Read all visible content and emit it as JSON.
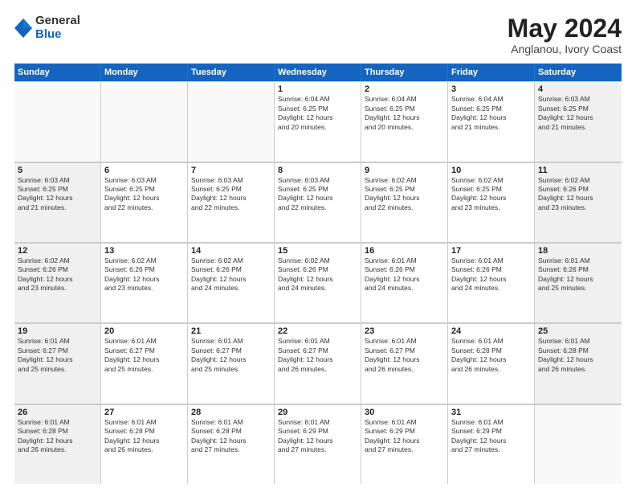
{
  "logo": {
    "general": "General",
    "blue": "Blue"
  },
  "title": "May 2024",
  "location": "Anglanou, Ivory Coast",
  "days": [
    "Sunday",
    "Monday",
    "Tuesday",
    "Wednesday",
    "Thursday",
    "Friday",
    "Saturday"
  ],
  "weeks": [
    [
      {
        "day": "",
        "text": ""
      },
      {
        "day": "",
        "text": ""
      },
      {
        "day": "",
        "text": ""
      },
      {
        "day": "1",
        "text": "Sunrise: 6:04 AM\nSunset: 6:25 PM\nDaylight: 12 hours\nand 20 minutes."
      },
      {
        "day": "2",
        "text": "Sunrise: 6:04 AM\nSunset: 6:25 PM\nDaylight: 12 hours\nand 20 minutes."
      },
      {
        "day": "3",
        "text": "Sunrise: 6:04 AM\nSunset: 6:25 PM\nDaylight: 12 hours\nand 21 minutes."
      },
      {
        "day": "4",
        "text": "Sunrise: 6:03 AM\nSunset: 6:25 PM\nDaylight: 12 hours\nand 21 minutes."
      }
    ],
    [
      {
        "day": "5",
        "text": "Sunrise: 6:03 AM\nSunset: 6:25 PM\nDaylight: 12 hours\nand 21 minutes."
      },
      {
        "day": "6",
        "text": "Sunrise: 6:03 AM\nSunset: 6:25 PM\nDaylight: 12 hours\nand 22 minutes."
      },
      {
        "day": "7",
        "text": "Sunrise: 6:03 AM\nSunset: 6:25 PM\nDaylight: 12 hours\nand 22 minutes."
      },
      {
        "day": "8",
        "text": "Sunrise: 6:03 AM\nSunset: 6:25 PM\nDaylight: 12 hours\nand 22 minutes."
      },
      {
        "day": "9",
        "text": "Sunrise: 6:02 AM\nSunset: 6:25 PM\nDaylight: 12 hours\nand 22 minutes."
      },
      {
        "day": "10",
        "text": "Sunrise: 6:02 AM\nSunset: 6:25 PM\nDaylight: 12 hours\nand 23 minutes."
      },
      {
        "day": "11",
        "text": "Sunrise: 6:02 AM\nSunset: 6:26 PM\nDaylight: 12 hours\nand 23 minutes."
      }
    ],
    [
      {
        "day": "12",
        "text": "Sunrise: 6:02 AM\nSunset: 6:26 PM\nDaylight: 12 hours\nand 23 minutes."
      },
      {
        "day": "13",
        "text": "Sunrise: 6:02 AM\nSunset: 6:26 PM\nDaylight: 12 hours\nand 23 minutes."
      },
      {
        "day": "14",
        "text": "Sunrise: 6:02 AM\nSunset: 6:26 PM\nDaylight: 12 hours\nand 24 minutes."
      },
      {
        "day": "15",
        "text": "Sunrise: 6:02 AM\nSunset: 6:26 PM\nDaylight: 12 hours\nand 24 minutes."
      },
      {
        "day": "16",
        "text": "Sunrise: 6:01 AM\nSunset: 6:26 PM\nDaylight: 12 hours\nand 24 minutes."
      },
      {
        "day": "17",
        "text": "Sunrise: 6:01 AM\nSunset: 6:26 PM\nDaylight: 12 hours\nand 24 minutes."
      },
      {
        "day": "18",
        "text": "Sunrise: 6:01 AM\nSunset: 6:26 PM\nDaylight: 12 hours\nand 25 minutes."
      }
    ],
    [
      {
        "day": "19",
        "text": "Sunrise: 6:01 AM\nSunset: 6:27 PM\nDaylight: 12 hours\nand 25 minutes."
      },
      {
        "day": "20",
        "text": "Sunrise: 6:01 AM\nSunset: 6:27 PM\nDaylight: 12 hours\nand 25 minutes."
      },
      {
        "day": "21",
        "text": "Sunrise: 6:01 AM\nSunset: 6:27 PM\nDaylight: 12 hours\nand 25 minutes."
      },
      {
        "day": "22",
        "text": "Sunrise: 6:01 AM\nSunset: 6:27 PM\nDaylight: 12 hours\nand 26 minutes."
      },
      {
        "day": "23",
        "text": "Sunrise: 6:01 AM\nSunset: 6:27 PM\nDaylight: 12 hours\nand 26 minutes."
      },
      {
        "day": "24",
        "text": "Sunrise: 6:01 AM\nSunset: 6:28 PM\nDaylight: 12 hours\nand 26 minutes."
      },
      {
        "day": "25",
        "text": "Sunrise: 6:01 AM\nSunset: 6:28 PM\nDaylight: 12 hours\nand 26 minutes."
      }
    ],
    [
      {
        "day": "26",
        "text": "Sunrise: 6:01 AM\nSunset: 6:28 PM\nDaylight: 12 hours\nand 26 minutes."
      },
      {
        "day": "27",
        "text": "Sunrise: 6:01 AM\nSunset: 6:28 PM\nDaylight: 12 hours\nand 26 minutes."
      },
      {
        "day": "28",
        "text": "Sunrise: 6:01 AM\nSunset: 6:28 PM\nDaylight: 12 hours\nand 27 minutes."
      },
      {
        "day": "29",
        "text": "Sunrise: 6:01 AM\nSunset: 6:29 PM\nDaylight: 12 hours\nand 27 minutes."
      },
      {
        "day": "30",
        "text": "Sunrise: 6:01 AM\nSunset: 6:29 PM\nDaylight: 12 hours\nand 27 minutes."
      },
      {
        "day": "31",
        "text": "Sunrise: 6:01 AM\nSunset: 6:29 PM\nDaylight: 12 hours\nand 27 minutes."
      },
      {
        "day": "",
        "text": ""
      }
    ]
  ]
}
